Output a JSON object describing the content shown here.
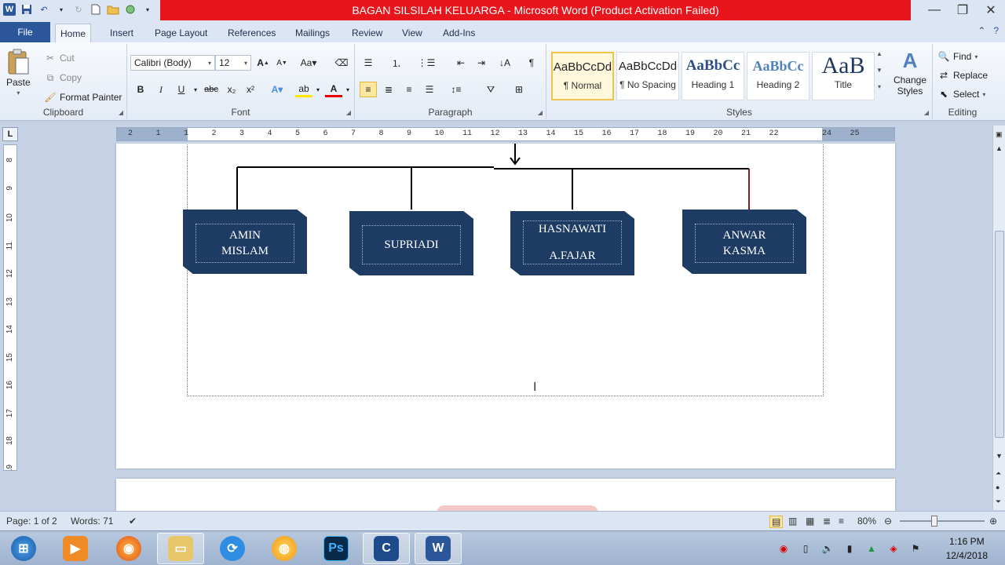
{
  "window": {
    "title": "BAGAN SILSILAH KELUARGA  -  Microsoft Word (Product Activation Failed)"
  },
  "tabs": [
    {
      "label": "File"
    },
    {
      "label": "Home"
    },
    {
      "label": "Insert"
    },
    {
      "label": "Page Layout"
    },
    {
      "label": "References"
    },
    {
      "label": "Mailings"
    },
    {
      "label": "Review"
    },
    {
      "label": "View"
    },
    {
      "label": "Add-Ins"
    }
  ],
  "clipboard": {
    "paste": "Paste",
    "cut": "Cut",
    "copy": "Copy",
    "format_painter": "Format Painter",
    "label": "Clipboard"
  },
  "font": {
    "name": "Calibri (Body)",
    "size": "12",
    "label": "Font"
  },
  "paragraph": {
    "label": "Paragraph"
  },
  "styles": {
    "items": [
      {
        "preview": "AaBbCcDd",
        "name": "¶ Normal"
      },
      {
        "preview": "AaBbCcDd",
        "name": "¶ No Spacing"
      },
      {
        "preview": "AaBbCc",
        "name": "Heading 1"
      },
      {
        "preview": "AaBbCc",
        "name": "Heading 2"
      },
      {
        "preview": "AaB",
        "name": "Title"
      }
    ],
    "change_styles": "Change Styles",
    "label": "Styles"
  },
  "editing": {
    "find": "Find",
    "replace": "Replace",
    "select": "Select",
    "label": "Editing"
  },
  "ruler": {
    "corner": "L",
    "h_numbers": [
      "2",
      "1",
      "1",
      "2",
      "3",
      "4",
      "5",
      "6",
      "7",
      "8",
      "9",
      "10",
      "11",
      "12",
      "13",
      "14",
      "15",
      "16",
      "17",
      "18",
      "19",
      "20",
      "21",
      "22",
      "24",
      "25"
    ],
    "v_numbers": [
      "8",
      "9",
      "10",
      "11",
      "12",
      "13",
      "14",
      "15",
      "16",
      "17",
      "18",
      "19"
    ]
  },
  "document": {
    "persons": [
      {
        "line1": "AMIN",
        "line2": "MISLAM"
      },
      {
        "line1": "SUPRIADI",
        "line2": ""
      },
      {
        "line1": "HASNAWATI",
        "line2": "A.FAJAR"
      },
      {
        "line1": "ANWAR",
        "line2": "KASMA"
      }
    ]
  },
  "status": {
    "page": "Page: 1 of 2",
    "words": "Words: 71",
    "zoom": "80%"
  },
  "taskbar": {
    "time": "1:16 PM",
    "date": "12/4/2018"
  }
}
